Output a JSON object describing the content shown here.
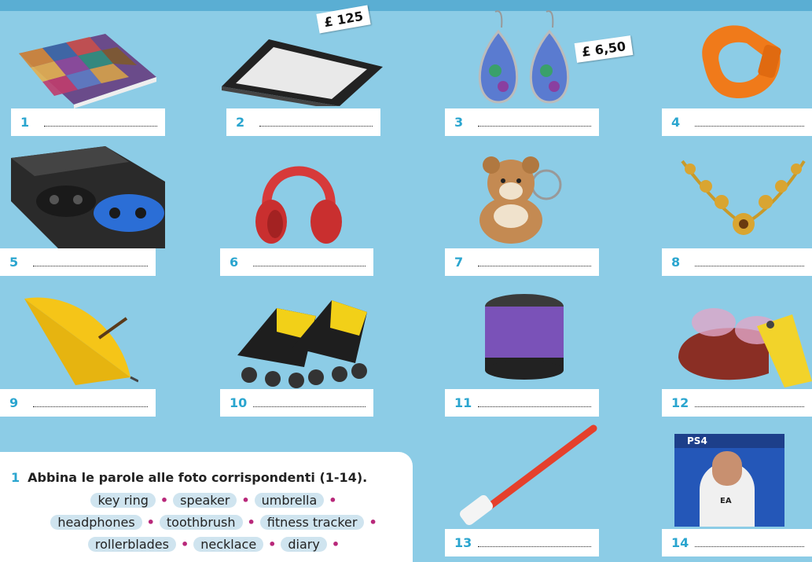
{
  "prices": {
    "ereader": "£ 125",
    "earrings": "£ 6,50"
  },
  "items": [
    {
      "number": "1"
    },
    {
      "number": "2"
    },
    {
      "number": "3"
    },
    {
      "number": "4"
    },
    {
      "number": "5"
    },
    {
      "number": "6"
    },
    {
      "number": "7"
    },
    {
      "number": "8"
    },
    {
      "number": "9"
    },
    {
      "number": "10"
    },
    {
      "number": "11"
    },
    {
      "number": "12"
    },
    {
      "number": "13"
    },
    {
      "number": "14"
    }
  ],
  "exercise": {
    "number": "1",
    "title": "Abbina le parole alle foto corrispondenti (1-14).",
    "words": [
      "key ring",
      "speaker",
      "umbrella",
      "headphones",
      "toothbrush",
      "fitness tracker",
      "rollerblades",
      "necklace",
      "diary"
    ]
  },
  "game_cover": {
    "brand": "PS4",
    "badge": "EA"
  },
  "colors": {
    "accent": "#2aa5cf",
    "background": "#8ccce6",
    "separator": "#b8287a"
  }
}
